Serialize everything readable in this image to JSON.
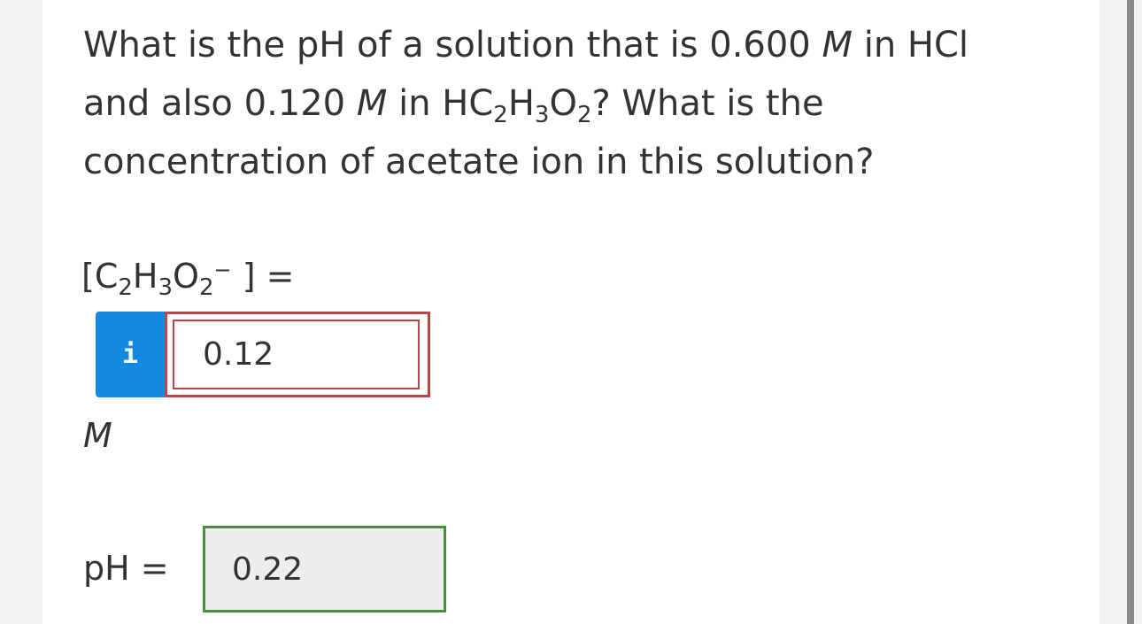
{
  "question": {
    "line1_prefix": "What is the pH of a solution that is 0.600 ",
    "line1_unit": "M",
    "line1_suffix": " in HCl",
    "line2_prefix": "and also 0.120 ",
    "line2_unit": "M",
    "line2_mid": " in HC",
    "line2_sub1": "2",
    "line2_h": "H",
    "line2_sub2": "3",
    "line2_o": "O",
    "line2_sub3": "2",
    "line2_suffix": "? What is the",
    "line3": "concentration of acetate ion in this solution?"
  },
  "acetate_field": {
    "label_open": "[C",
    "label_sub1": "2",
    "label_h": "H",
    "label_sub2": "3",
    "label_o": "O",
    "label_sub3": "2",
    "label_sup": "−",
    "label_close": " ] =",
    "info_icon": "i",
    "value": "0.12",
    "unit": "M",
    "border_color": "#bb4444"
  },
  "ph_field": {
    "label": "pH =",
    "value": "0.22",
    "border_color": "#4a8f3e"
  },
  "colors": {
    "info_button": "#1489e1",
    "text": "#333333"
  }
}
